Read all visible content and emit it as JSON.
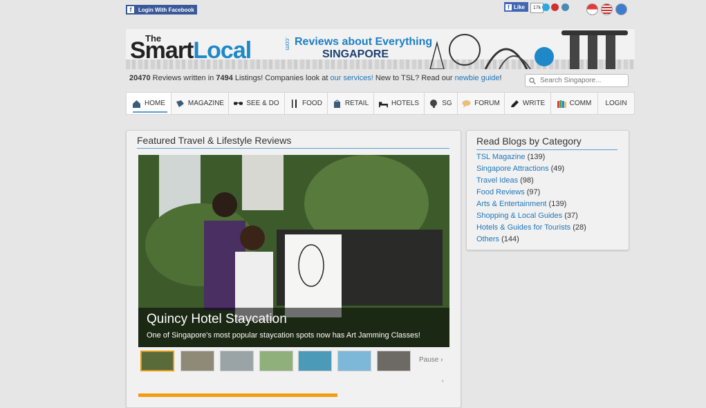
{
  "topbar": {
    "fb_login": "Login With Facebook",
    "fb_like": "Like",
    "like_count": "17k"
  },
  "header": {
    "logo_the": "The",
    "logo_smart": "Smart",
    "logo_local": "Local",
    "logo_com": ".com",
    "tagline": "Reviews about Everything",
    "tagline_sub": "SINGAPORE"
  },
  "info": {
    "reviews_count": "20470",
    "text1": " Reviews written in ",
    "listings_count": "7494",
    "text2": " Listings! Companies look at ",
    "services_link": "our services!",
    "text3": " New to TSL? Read our ",
    "guide_link": "newbie guide",
    "text4": "!"
  },
  "search": {
    "placeholder": "Search Singapore..."
  },
  "nav": [
    "HOME",
    "MAGAZINE",
    "SEE & DO",
    "FOOD",
    "RETAIL",
    "HOTELS",
    "SG",
    "FORUM",
    "WRITE",
    "COMM",
    "LOGIN"
  ],
  "featured": {
    "title": "Featured Travel & Lifestyle Reviews",
    "slide_title": "Quincy Hotel Staycation",
    "slide_sub": "One of Singapore's most popular staycation spots now has Art Jamming Classes!",
    "pause": "Pause ›",
    "prev": "‹",
    "progress": 0.64
  },
  "categories": {
    "title": "Read Blogs by Category",
    "items": [
      {
        "label": "TSL Magazine",
        "count": " (139)"
      },
      {
        "label": "Singapore Attractions",
        "count": " (49)"
      },
      {
        "label": "Travel Ideas",
        "count": " (98)"
      },
      {
        "label": "Food Reviews",
        "count": " (97)"
      },
      {
        "label": "Arts & Entertainment",
        "count": " (139)"
      },
      {
        "label": "Shopping & Local Guides",
        "count": " (37)"
      },
      {
        "label": "Hotels & Guides for Tourists",
        "count": " (28)"
      },
      {
        "label": "Others",
        "count": " (144)"
      }
    ]
  },
  "colors": {
    "accent": "#1f76b9",
    "progress": "#f39c12",
    "facebook": "#3b5998"
  }
}
